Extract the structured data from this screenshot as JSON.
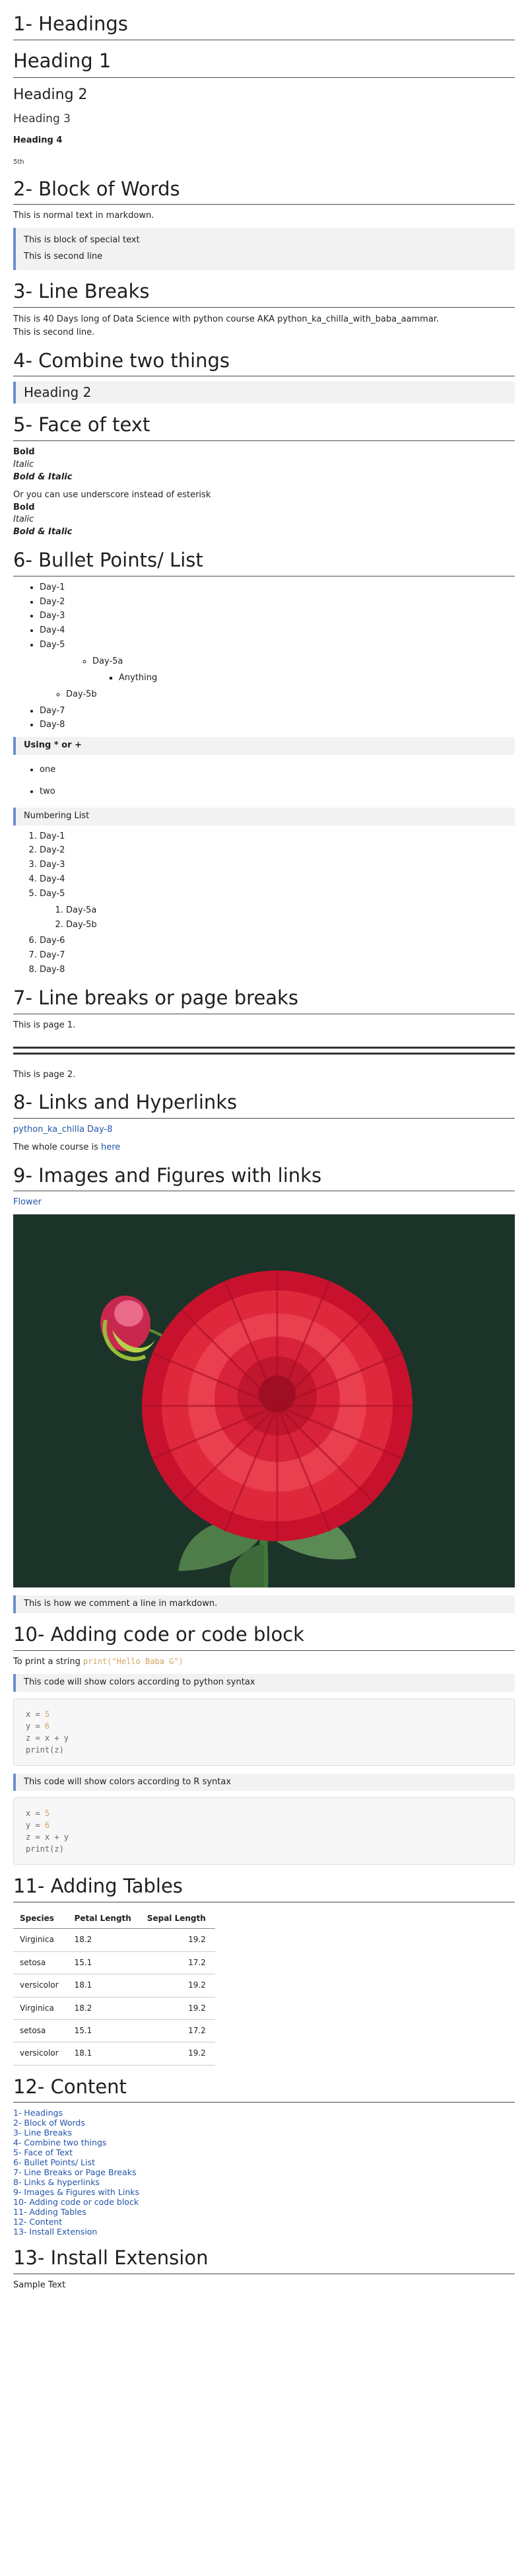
{
  "s1": {
    "title": "1- Headings",
    "h1": "Heading 1",
    "h2": "Heading 2",
    "h3": "Heading 3",
    "h4": "Heading 4",
    "h5": "5th"
  },
  "s2": {
    "title": "2- Block of Words",
    "text": "This is normal text in markdown.",
    "q1": "This is block of special text",
    "q2": "This is second line"
  },
  "s3": {
    "title": "3- Line Breaks",
    "line1": "This is 40 Days long of Data Science with python course AKA python_ka_chilla_with_baba_aammar.",
    "line2": "This is second line."
  },
  "s4": {
    "title": "4- Combine two things",
    "quote": "Heading 2"
  },
  "s5": {
    "title": "5- Face of text",
    "bold": "Bold",
    "italic": "Italic",
    "bi": "Bold & Italic",
    "note": "Or you can use underscore instead of esterisk",
    "bold2": "Bold",
    "italic2": "Italic",
    "bi2": "Bold & Italic"
  },
  "s6": {
    "title": "6- Bullet Points/ List",
    "days": [
      "Day-1",
      "Day-2",
      "Day-3",
      "Day-4",
      "Day-5"
    ],
    "sub5a": "Day-5a",
    "anything": "Anything",
    "sub5b": "Day-5b",
    "days_after": [
      "Day-7",
      "Day-8"
    ],
    "quote_using": "Using * or +",
    "one": "one",
    "two": "two",
    "quote_numbering": "Numbering List",
    "ndays": [
      "Day-1",
      "Day-2",
      "Day-3",
      "Day-4",
      "Day-5"
    ],
    "nsub": [
      "Day-5a",
      "Day-5b"
    ],
    "ndays_after": [
      "Day-6",
      "Day-7",
      "Day-8"
    ]
  },
  "s7": {
    "title": "7- Line breaks or page breaks",
    "p1": "This is page 1.",
    "p2": "This is page 2."
  },
  "s8": {
    "title": "8- Links and Hyperlinks",
    "link1": "python_ka_chilla Day-8",
    "text2": "The whole course is ",
    "link2": "here"
  },
  "s9": {
    "title": "9- Images and Figures with links",
    "link": "Flower",
    "comment": "This is how we comment a line in markdown."
  },
  "s10": {
    "title": "10- Adding code or code block",
    "print_text": "To print a string ",
    "print_code": "print(\"Hello Baba G\")",
    "q_python": "This code will show colors according to python syntax",
    "q_r": "This code will show colors according to R syntax",
    "code": {
      "x_pre": "x = ",
      "x_val": "5",
      "y_pre": "y = ",
      "y_val": "6",
      "z": "z = x + y",
      "p": "print(z)"
    }
  },
  "s11": {
    "title": "11- Adding Tables",
    "headers": [
      "Species",
      "Petal Length",
      "Sepal Length"
    ],
    "rows": [
      [
        "Virginica",
        "18.2",
        "19.2"
      ],
      [
        "setosa",
        "15.1",
        "17.2"
      ],
      [
        "versicolor",
        "18.1",
        "19.2"
      ],
      [
        "Virginica",
        "18.2",
        "19.2"
      ],
      [
        "setosa",
        "15.1",
        "17.2"
      ],
      [
        "versicolor",
        "18.1",
        "19.2"
      ]
    ]
  },
  "s12": {
    "title": "12- Content",
    "items": [
      "1- Headings",
      "2- Block of Words",
      "3- Line Breaks",
      "4- Combine two things",
      "5- Face of Text",
      "6- Bullet Points/ List",
      "7- Line Breaks or Page Breaks",
      "8- Links & hyperlinks",
      "9- Images & Figures with Links",
      "10- Adding code or code block",
      "11- Adding Tables",
      "12- Content",
      "13- Install Extension"
    ]
  },
  "s13": {
    "title": "13- Install Extension",
    "text": "Sample Text"
  },
  "colors": {
    "link": "#2255aa",
    "quote_bar": "#6b8fc8",
    "code_number": "#d4a160",
    "photo_bg": "#1c3329",
    "flower": "#e0283c"
  }
}
